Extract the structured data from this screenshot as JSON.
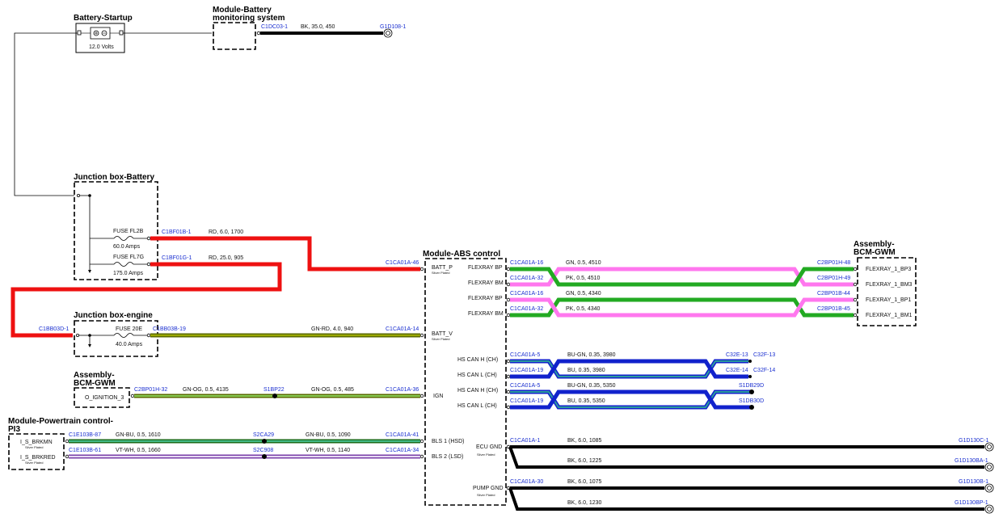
{
  "components": {
    "battery": {
      "title": "Battery-Startup",
      "label": "12.0 Volts"
    },
    "bms": {
      "title1": "Module-Battery",
      "title2": "monitoring system"
    },
    "jb_battery": {
      "title": "Junction box-Battery",
      "fuse1": {
        "name": "FUSE FL2B",
        "rating": "60.0 Amps"
      },
      "fuse2": {
        "name": "FUSE FL7G",
        "rating": "175.0 Amps"
      }
    },
    "jb_engine": {
      "title": "Junction box-engine",
      "fuse": {
        "name": "FUSE 20E",
        "rating": "40.0 Amps"
      }
    },
    "bcm_left": {
      "title1": "Assembly-",
      "title2": "BCM-GWM",
      "pin": "O_IGNITION_3"
    },
    "pcm": {
      "title1": "Module-Powertrain control-",
      "title2": "PI3",
      "pin1": "I_S_BRKMN",
      "pin2": "I_S_BRKRED",
      "plated": "Silver Plated"
    },
    "abs": {
      "title": "Module-ABS control",
      "pins": [
        "BATT_P",
        "BATT_V",
        "IGN",
        "BLS 1 (HSD)",
        "BLS 2 (LSD)"
      ],
      "plated": "Silver Plated",
      "right_pins": [
        "FLEXRAY BP",
        "FLEXRAY BM",
        "FLEXRAY BP",
        "FLEXRAY BM",
        "HS CAN H (CH)",
        "HS CAN L (CH)",
        "HS CAN H (CH)",
        "HS CAN L (CH)",
        "ECU GND",
        "PUMP GND"
      ]
    },
    "bcm_right": {
      "title1": "Assembly-",
      "title2": "BCM-GWM",
      "pins": [
        "FLEXRAY_1_BP3",
        "FLEXRAY_1_BM3",
        "FLEXRAY_1_BP1",
        "FLEXRAY_1_BM1"
      ]
    }
  },
  "wires": {
    "w_bms": {
      "from": "C1DC03-1",
      "spec": "BK, 35.0, 450",
      "to": "G1D108-1"
    },
    "w_rd6": {
      "from": "C1BF01B-1",
      "spec": "RD, 6.0, 1700",
      "to": "C1CA01A-46"
    },
    "w_rd25": {
      "from": "C1BF01G-1",
      "spec": "RD, 25.0, 905",
      "to": "C1BB03D-1"
    },
    "w_gnrd": {
      "from": "C1BB03B-19",
      "spec": "GN-RD, 4.0, 940",
      "to": "C1CA01A-14"
    },
    "w_gnog1": {
      "from": "C2BP01H-32",
      "spec": "GN-OG, 0.5, 4135",
      "splice": "S1BP22"
    },
    "w_gnog2": {
      "spec": "GN-OG, 0.5, 485",
      "to": "C1CA01A-36"
    },
    "w_gnbu1": {
      "from": "C1E103B-87",
      "spec": "GN-BU, 0.5, 1610",
      "splice": "S2CA29"
    },
    "w_gnbu2": {
      "spec": "GN-BU, 0.5, 1090",
      "to": "C1CA01A-41"
    },
    "w_vtwh1": {
      "from": "C1E103B-61",
      "spec": "VT-WH, 0.5, 1660",
      "splice": "S2C908"
    },
    "w_vtwh2": {
      "spec": "VT-WH, 0.5, 1140",
      "to": "C1CA01A-34"
    },
    "w_fx1": {
      "from": "C1CA01A-16",
      "spec": "GN, 0.5, 4510",
      "to": "C2BP01H-48"
    },
    "w_fx2": {
      "from": "C1CA01A-32",
      "spec": "PK, 0.5, 4510",
      "to": "C2BP01H-49"
    },
    "w_fx3": {
      "from": "C1CA01A-16",
      "spec": "GN, 0.5, 4340",
      "to": "C2BP01B-44"
    },
    "w_fx4": {
      "from": "C1CA01A-32",
      "spec": "PK, 0.5, 4340",
      "to": "C2BP01B-45"
    },
    "w_can1": {
      "from": "C1CA01A-5",
      "spec": "BU-GN, 0.35, 3980",
      "to": "C32E-13",
      "to2": "C32F-13"
    },
    "w_can2": {
      "from": "C1CA01A-19",
      "spec": "BU, 0.35, 3980",
      "to": "C32E-14",
      "to2": "C32F-14"
    },
    "w_can3": {
      "from": "C1CA01A-5",
      "spec": "BU-GN, 0.35, 5350",
      "to": "S1DB29D"
    },
    "w_can4": {
      "from": "C1CA01A-19",
      "spec": "BU, 0.35, 5350",
      "to": "S1DB30D"
    },
    "w_gnd1": {
      "from": "C1CA01A-1",
      "spec": "BK, 6.0, 1085",
      "to": "G1D130C-1"
    },
    "w_gnd2": {
      "spec": "BK, 6.0, 1225",
      "to": "G1D130BA-1"
    },
    "w_gnd3": {
      "from": "C1CA01A-30",
      "spec": "BK, 6.0, 1075",
      "to": "G1D130B-1"
    },
    "w_gnd4": {
      "spec": "BK, 6.0, 1230",
      "to": "G1D130BP-1"
    }
  },
  "colors": {
    "red": "#ee1111",
    "black": "#000000",
    "green": "#22aa22",
    "pink": "#ff77ee",
    "blue": "#1122cc",
    "teal": "#2b9b9b",
    "olive": "#7a8a00",
    "lightgreen": "#88cc66",
    "violet": "#9955cc"
  }
}
